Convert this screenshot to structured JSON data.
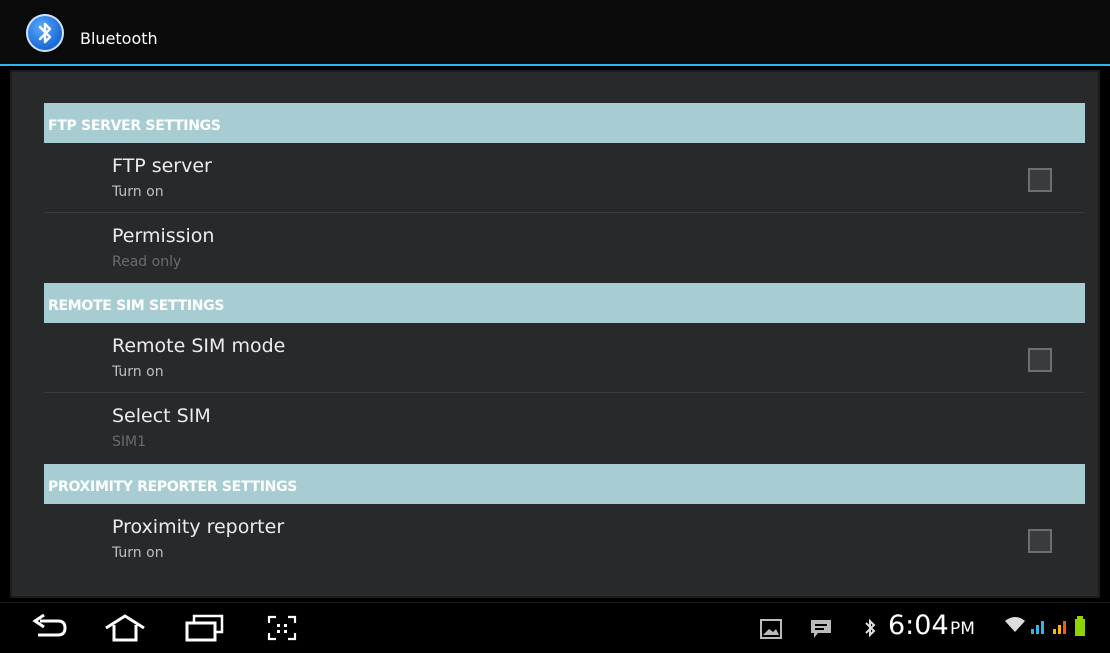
{
  "app": {
    "title": "Bluetooth"
  },
  "sections": [
    {
      "header": "FTP SERVER SETTINGS"
    },
    {
      "header": "REMOTE SIM SETTINGS"
    },
    {
      "header": "PROXIMITY REPORTER SETTINGS"
    }
  ],
  "items": {
    "ftp_server": {
      "label": "FTP server",
      "summary": "Turn on",
      "checked": false
    },
    "permission": {
      "label": "Permission",
      "summary": "Read only"
    },
    "remote_sim_mode": {
      "label": "Remote SIM mode",
      "summary": "Turn on",
      "checked": false
    },
    "select_sim": {
      "label": "Select SIM",
      "summary": "SIM1"
    },
    "proximity_reporter": {
      "label": "Proximity reporter",
      "summary": "Turn on",
      "checked": false
    }
  },
  "status_bar": {
    "time": "6:04",
    "ampm": "PM"
  },
  "colors": {
    "accent": "#33b5e5",
    "header_bg": "#a7cdd2",
    "content_bg": "#28292b"
  },
  "icons": {
    "nav": [
      "back-icon",
      "home-icon",
      "recents-icon",
      "screenshot-icon"
    ],
    "status": [
      "gallery-notification-icon",
      "message-notification-icon",
      "bluetooth-status-icon",
      "wifi-icon",
      "signal-icon",
      "signal-icon-2",
      "battery-icon"
    ]
  }
}
